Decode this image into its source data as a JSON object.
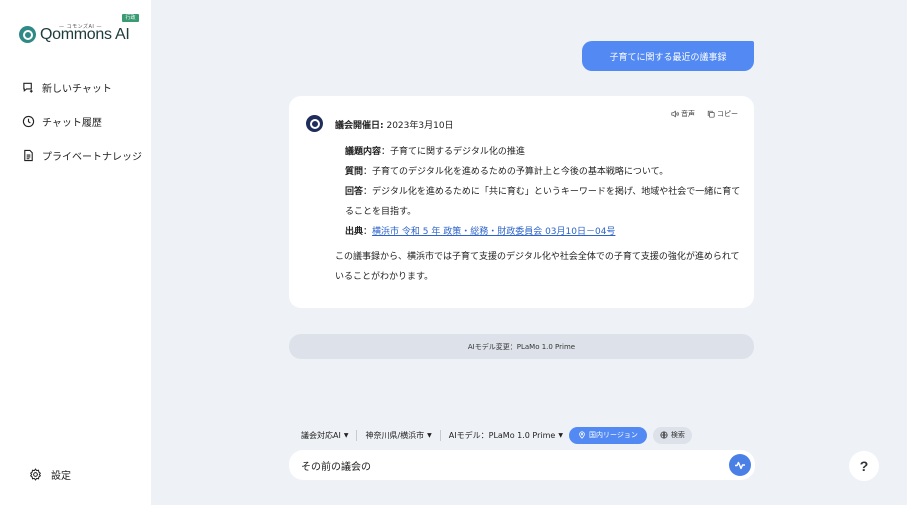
{
  "logo": {
    "brand": "Qommons AI",
    "subtitle": "— コモンズAI —",
    "badge": "行政"
  },
  "sidebar": {
    "items": [
      {
        "label": "新しいチャット",
        "icon": "new-chat-icon"
      },
      {
        "label": "チャット履歴",
        "icon": "history-icon"
      },
      {
        "label": "プライベートナレッジ",
        "icon": "document-icon"
      }
    ],
    "settings_label": "設定"
  },
  "chat": {
    "user_message": "子育てに関する最近の議事録",
    "actions": {
      "audio_label": "音声",
      "copy_label": "コピー"
    },
    "answer": {
      "date_label": "議会開催日:",
      "date_value": " 2023年3月10日",
      "topic_label": "議題内容",
      "topic_value": "：子育てに関するデジタル化の推進",
      "question_label": "質問",
      "question_value": "：子育てのデジタル化を進めるための予算計上と今後の基本戦略について。",
      "reply_label": "回答",
      "reply_value": "：デジタル化を進めるために「共に育む」というキーワードを掲げ、地域や社会で一緒に育てることを目指す。",
      "source_label": "出典",
      "source_sep": "：",
      "source_link": "横浜市 令和 5 年 政策・総務・財政委員会 03月10日－04号",
      "summary": "この議事録から、横浜市では子育て支援のデジタル化や社会全体での子育て支援の強化が進められていることがわかります。"
    }
  },
  "model_notice": "AIモデル変更：PLaMo 1.0 Prime",
  "toolbar": {
    "mode": "議会対応AI",
    "region": "神奈川県/横浜市",
    "model": "AIモデル：PLaMo 1.0 Prime",
    "domestic_region": "国内リージョン",
    "search": "検索"
  },
  "input": {
    "value": "その前の議会の"
  },
  "help": {
    "label": "?"
  },
  "colors": {
    "accent": "#5289f2",
    "main_bg": "#eef1f5",
    "logo_green": "#2f8a86"
  }
}
